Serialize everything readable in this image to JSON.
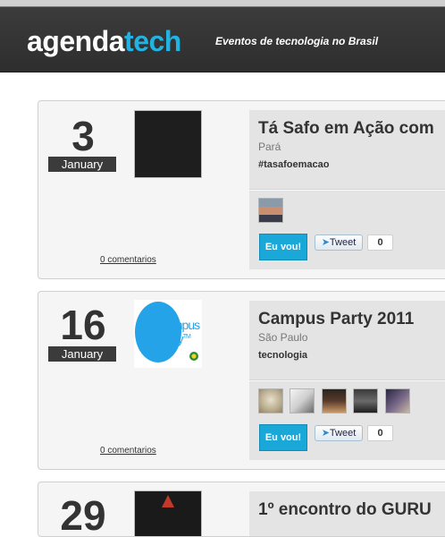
{
  "header": {
    "logo_part1": "agenda",
    "logo_part2": "tech",
    "tagline": "Eventos de tecnologia no Brasil"
  },
  "events": [
    {
      "day": "3",
      "month": "January",
      "title": "Tá Safo em Ação com",
      "location": "Pará",
      "tag": "#tasafoemacao",
      "comments": "0 comentarios",
      "go_label": "Eu vou!",
      "tweet_label": "Tweet",
      "tweet_count": "0"
    },
    {
      "day": "16",
      "month": "January",
      "logo_text_line1": "Campus",
      "logo_text_line2": "Party",
      "logo_tm": "TM",
      "title": "Campus Party 2011",
      "location": "São Paulo",
      "tag": "tecnologia",
      "comments": "0 comentarios",
      "go_label": "Eu vou!",
      "tweet_label": "Tweet",
      "tweet_count": "0"
    },
    {
      "day": "29",
      "title": "1º encontro do GURU"
    }
  ],
  "colors": {
    "accent": "#23b3e3",
    "button": "#1aa8d9",
    "header_bg": "#333333"
  }
}
